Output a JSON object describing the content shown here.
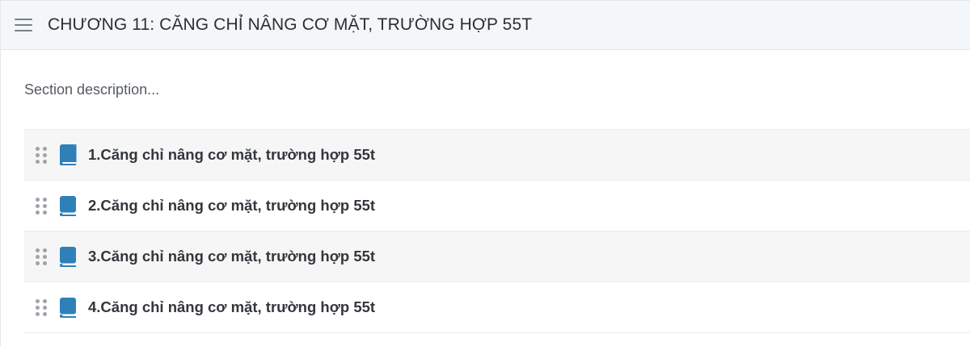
{
  "section": {
    "title": "CHƯƠNG 11: CĂNG CHỈ NÂNG CƠ MẶT, TRƯỜNG HỢP 55T",
    "description": "Section description..."
  },
  "lessons": [
    {
      "title": "1.Căng chỉ nâng cơ mặt, trường hợp 55t",
      "icon": "book-icon"
    },
    {
      "title": "2.Căng chỉ nâng cơ mặt, trường hợp 55t",
      "icon": "book-icon"
    },
    {
      "title": "3.Căng chỉ nâng cơ mặt, trường hợp 55t",
      "icon": "book-icon"
    },
    {
      "title": "4.Căng chỉ nâng cơ mặt, trường hợp 55t",
      "icon": "book-icon"
    }
  ],
  "colors": {
    "book_icon": "#2f80b8",
    "header_bg": "#f4f7f9",
    "row_alt_bg": "#f6f6f6"
  }
}
